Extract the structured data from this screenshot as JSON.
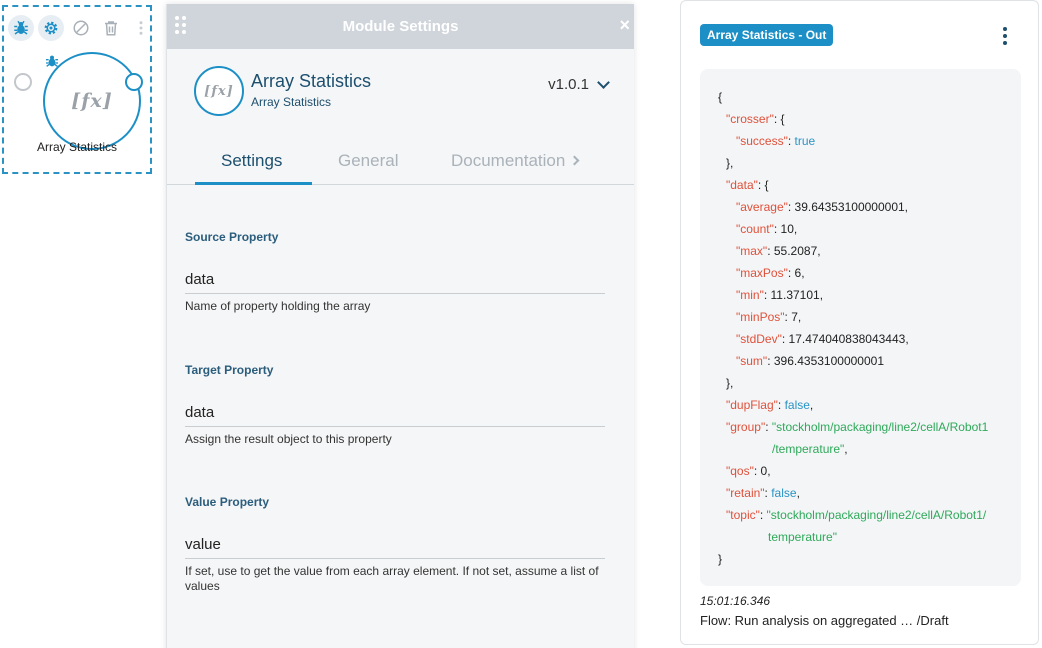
{
  "node": {
    "label": "Array Statistics",
    "icon_text": "[fx]",
    "toolbar": [
      "debug-icon",
      "settings-icon",
      "disable-icon",
      "delete-icon",
      "more-icon"
    ]
  },
  "panel": {
    "title": "Module Settings",
    "close": "×",
    "module": {
      "title": "Array Statistics",
      "subtitle": "Array Statistics",
      "icon_text": "[fx]",
      "version": "v1.0.1"
    },
    "tabs": [
      "Settings",
      "General",
      "Documentation"
    ],
    "fields": [
      {
        "label": "Source Property",
        "value": "data",
        "help": "Name of property holding the array"
      },
      {
        "label": "Target Property",
        "value": "data",
        "help": "Assign the result object to this property"
      },
      {
        "label": "Value Property",
        "value": "value",
        "help": "If set, use to get the value from each array element. If not set, assume a list of values"
      }
    ]
  },
  "output": {
    "badge": "Array Statistics - Out",
    "json_lines": [
      [
        {
          "t": "{",
          "c": "p"
        }
      ],
      [
        {
          "t": "\"crosser\"",
          "c": "k"
        },
        {
          "t": ": {",
          "c": "p"
        }
      ],
      [
        {
          "t": "\"success\"",
          "c": "k"
        },
        {
          "t": ": ",
          "c": "p"
        },
        {
          "t": "true",
          "c": "b"
        }
      ],
      [
        {
          "t": "},",
          "c": "p"
        }
      ],
      [
        {
          "t": "\"data\"",
          "c": "k"
        },
        {
          "t": ": {",
          "c": "p"
        }
      ],
      [
        {
          "t": "\"average\"",
          "c": "k"
        },
        {
          "t": ": 39.64353100000001,",
          "c": "p"
        }
      ],
      [
        {
          "t": "\"count\"",
          "c": "k"
        },
        {
          "t": ": 10,",
          "c": "p"
        }
      ],
      [
        {
          "t": "\"max\"",
          "c": "k"
        },
        {
          "t": ": 55.2087,",
          "c": "p"
        }
      ],
      [
        {
          "t": "\"maxPos\"",
          "c": "k"
        },
        {
          "t": ": 6,",
          "c": "p"
        }
      ],
      [
        {
          "t": "\"min\"",
          "c": "k"
        },
        {
          "t": ": 11.37101,",
          "c": "p"
        }
      ],
      [
        {
          "t": "\"minPos\"",
          "c": "k"
        },
        {
          "t": ": 7,",
          "c": "p"
        }
      ],
      [
        {
          "t": "\"stdDev\"",
          "c": "k"
        },
        {
          "t": ": 17.474040838043443,",
          "c": "p"
        }
      ],
      [
        {
          "t": "\"sum\"",
          "c": "k"
        },
        {
          "t": ": 396.4353100000001",
          "c": "p"
        }
      ],
      [
        {
          "t": "},",
          "c": "p"
        }
      ],
      [
        {
          "t": "\"dupFlag\"",
          "c": "k"
        },
        {
          "t": ": ",
          "c": "p"
        },
        {
          "t": "false",
          "c": "b"
        },
        {
          "t": ",",
          "c": "p"
        }
      ],
      [
        {
          "t": "\"group\"",
          "c": "k"
        },
        {
          "t": ": ",
          "c": "p"
        },
        {
          "t": "\"stockholm/packaging/line2/cellA/Robot1",
          "c": "s"
        }
      ],
      [
        {
          "t": "/temperature\"",
          "c": "s"
        },
        {
          "t": ",",
          "c": "p"
        }
      ],
      [
        {
          "t": "\"qos\"",
          "c": "k"
        },
        {
          "t": ": 0,",
          "c": "p"
        }
      ],
      [
        {
          "t": "\"retain\"",
          "c": "k"
        },
        {
          "t": ": ",
          "c": "p"
        },
        {
          "t": "false",
          "c": "b"
        },
        {
          "t": ",",
          "c": "p"
        }
      ],
      [
        {
          "t": "\"topic\"",
          "c": "k"
        },
        {
          "t": ": ",
          "c": "p"
        },
        {
          "t": "\"stockholm/packaging/line2/cellA/Robot1/",
          "c": "s"
        }
      ],
      [
        {
          "t": "temperature\"",
          "c": "s"
        }
      ],
      [
        {
          "t": "}",
          "c": "p"
        }
      ]
    ],
    "timestamp": "15:01:16.346",
    "flow": "Flow: Run analysis on aggregated … /Draft"
  },
  "colors": {
    "accent": "#1c8fc6",
    "header_bg": "#cfd5db",
    "json_key": "#e0513a",
    "json_string": "#2fa95a",
    "json_bool": "#2a93c4"
  }
}
